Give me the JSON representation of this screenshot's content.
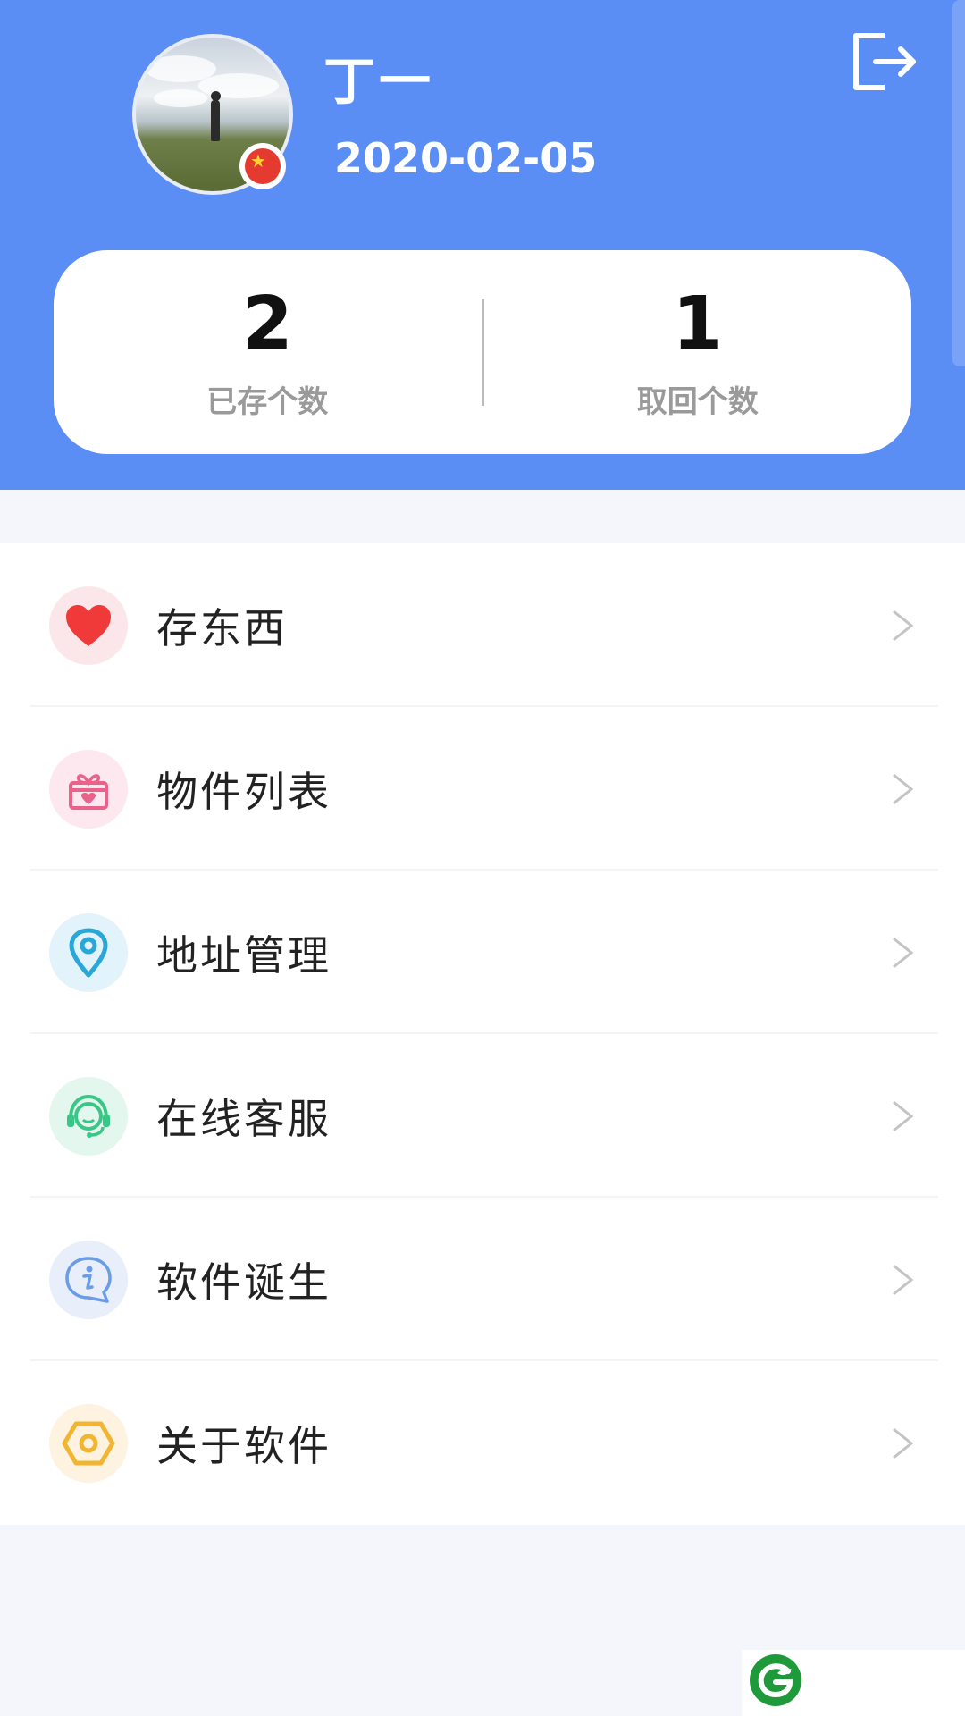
{
  "profile": {
    "name": "丁一",
    "date": "2020-02-05"
  },
  "stats": [
    {
      "value": "2",
      "label": "已存个数"
    },
    {
      "value": "1",
      "label": "取回个数"
    }
  ],
  "menu": {
    "items": [
      {
        "label": "存东西",
        "icon": "heart-icon",
        "color": "#f03a3a"
      },
      {
        "label": "物件列表",
        "icon": "gift-icon",
        "color": "#e8628a"
      },
      {
        "label": "地址管理",
        "icon": "location-pin-icon",
        "color": "#2aa7d9"
      },
      {
        "label": "在线客服",
        "icon": "headset-icon",
        "color": "#39c787"
      },
      {
        "label": "软件诞生",
        "icon": "info-icon",
        "color": "#6b9de6"
      },
      {
        "label": "关于软件",
        "icon": "hexagon-icon",
        "color": "#f2b531"
      }
    ]
  },
  "colors": {
    "header": "#5b8ef4",
    "background": "#f5f6fc"
  }
}
